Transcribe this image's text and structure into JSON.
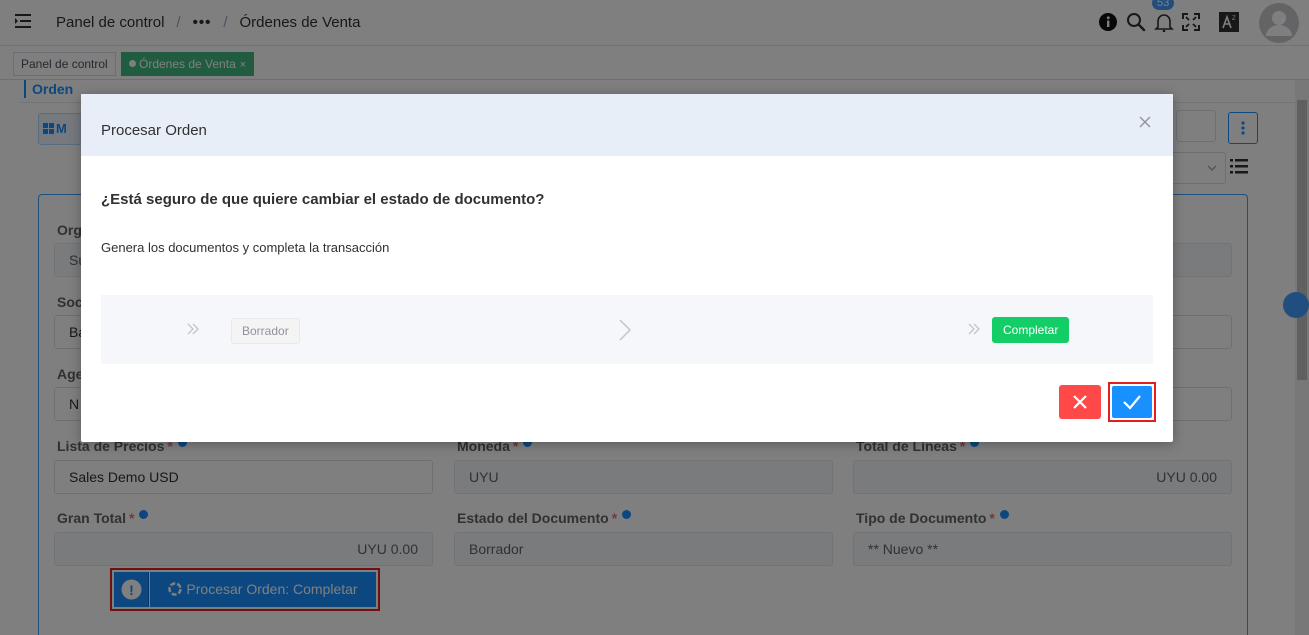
{
  "navbar": {
    "breadcrumb": {
      "root": "Panel de control",
      "separator": "/",
      "ellipsis": "•••",
      "current": "Órdenes de Venta"
    },
    "notification_count": "53",
    "icons": [
      "hamburger-icon",
      "info-icon",
      "search-icon",
      "bell-icon",
      "fullscreen-icon",
      "language-icon",
      "user-avatar-icon"
    ]
  },
  "tags": {
    "items": [
      {
        "label": "Panel de control"
      },
      {
        "label": "Órdenes de Venta",
        "close": "×"
      }
    ]
  },
  "page": {
    "tab": "Orden",
    "m_button": "M",
    "fields": {
      "org_label": "Org",
      "org_value": "Su",
      "soc_label": "Soc",
      "soc_value": "Ba",
      "age_label": "Age",
      "age_value": "N",
      "price_list_label": "Lista de Precios",
      "price_list_value": "Sales Demo USD",
      "currency_label": "Moneda",
      "currency_value": "UYU",
      "total_lines_label": "Total de Líneas",
      "total_lines_value": "UYU 0.00",
      "grand_total_label": "Gran Total",
      "grand_total_value": "UYU 0.00",
      "doc_status_label": "Estado del Documento",
      "doc_status_value": "Borrador",
      "doc_type_label": "Tipo de Documento",
      "doc_type_value": "** Nuevo **",
      "required_mark": "*"
    },
    "process_button": "Procesar Orden: Completar",
    "process_alert": "!"
  },
  "dialog": {
    "title": "Procesar Orden",
    "question": "¿Está seguro de que quiere cambiar el estado de documento?",
    "description": "Genera los documentos y completa la transacción",
    "from_status": "Borrador",
    "to_status": "Completar"
  },
  "colors": {
    "primary": "#1890ff",
    "success": "#13ce66",
    "danger": "#ff4949",
    "highlight_border": "#e02020",
    "tag_active": "#42b983",
    "dialog_header": "#e8eef7"
  }
}
